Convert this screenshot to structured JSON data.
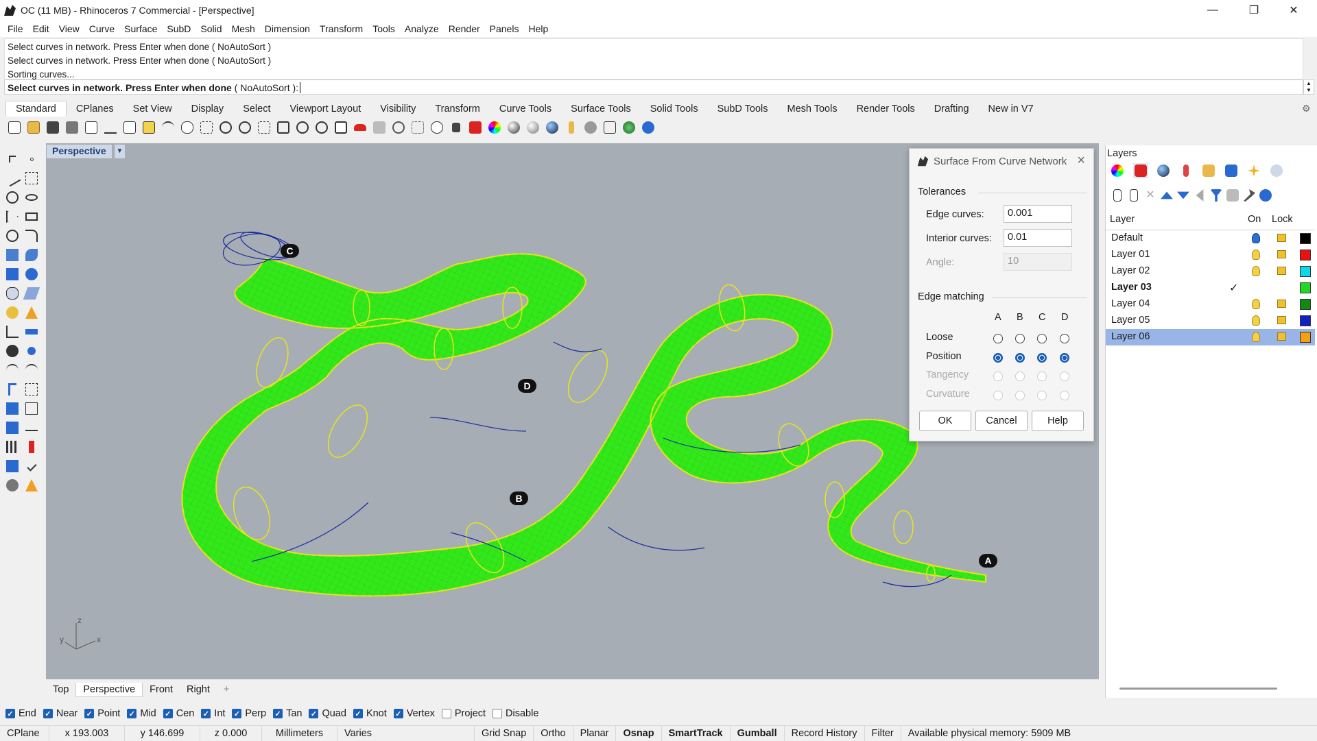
{
  "window": {
    "title": "OC (11 MB) - Rhinoceros 7 Commercial - [Perspective]",
    "minimize": "—",
    "restore": "❐",
    "close": "✕"
  },
  "menu": [
    "File",
    "Edit",
    "View",
    "Curve",
    "Surface",
    "SubD",
    "Solid",
    "Mesh",
    "Dimension",
    "Transform",
    "Tools",
    "Analyze",
    "Render",
    "Panels",
    "Help"
  ],
  "command": {
    "history": [
      "Select curves in network. Press Enter when done ( NoAutoSort )",
      "Select curves in network. Press Enter when done ( NoAutoSort )",
      "Sorting curves..."
    ],
    "prompt": "Select curves in network. Press Enter when done",
    "options": " ( NoAutoSort ):"
  },
  "toolbar_tabs": [
    "Standard",
    "CPlanes",
    "Set View",
    "Display",
    "Select",
    "Viewport Layout",
    "Visibility",
    "Transform",
    "Curve Tools",
    "Surface Tools",
    "Solid Tools",
    "SubD Tools",
    "Mesh Tools",
    "Render Tools",
    "Drafting",
    "New in V7"
  ],
  "viewport": {
    "title": "Perspective",
    "markers": [
      "A",
      "B",
      "C",
      "D"
    ],
    "axes": {
      "x": "x",
      "y": "y",
      "z": "z"
    },
    "surface_color": "#33e81a",
    "background": "#a7adb4"
  },
  "viewport_tabs": [
    "Top",
    "Perspective",
    "Front",
    "Right",
    "+"
  ],
  "osnaps": [
    {
      "label": "End",
      "checked": true
    },
    {
      "label": "Near",
      "checked": true
    },
    {
      "label": "Point",
      "checked": true
    },
    {
      "label": "Mid",
      "checked": true
    },
    {
      "label": "Cen",
      "checked": true
    },
    {
      "label": "Int",
      "checked": true
    },
    {
      "label": "Perp",
      "checked": true
    },
    {
      "label": "Tan",
      "checked": true
    },
    {
      "label": "Quad",
      "checked": true
    },
    {
      "label": "Knot",
      "checked": true
    },
    {
      "label": "Vertex",
      "checked": true
    },
    {
      "label": "Project",
      "checked": false
    },
    {
      "label": "Disable",
      "checked": false
    }
  ],
  "status": {
    "cplane": "CPlane",
    "x": "x 193.003",
    "y": "y 146.699",
    "z": "z 0.000",
    "units": "Millimeters",
    "layer": "Varies",
    "grid_snap": "Grid Snap",
    "ortho": "Ortho",
    "planar": "Planar",
    "osnap": "Osnap",
    "smarttrack": "SmartTrack",
    "gumball": "Gumball",
    "record_history": "Record History",
    "filter": "Filter",
    "memory": "Available physical memory: 5909 MB"
  },
  "dialog": {
    "title": "Surface From Curve Network",
    "tolerances_label": "Tolerances",
    "edge_curves_label": "Edge curves:",
    "edge_curves_value": "0.001",
    "interior_curves_label": "Interior curves:",
    "interior_curves_value": "0.01",
    "angle_label": "Angle:",
    "angle_value": "10",
    "edge_matching_label": "Edge matching",
    "columns": [
      "A",
      "B",
      "C",
      "D"
    ],
    "rows": [
      {
        "label": "Loose",
        "enabled": true,
        "selected": [
          false,
          false,
          false,
          false
        ]
      },
      {
        "label": "Position",
        "enabled": true,
        "selected": [
          true,
          true,
          true,
          true
        ]
      },
      {
        "label": "Tangency",
        "enabled": false,
        "selected": [
          false,
          false,
          false,
          false
        ]
      },
      {
        "label": "Curvature",
        "enabled": false,
        "selected": [
          false,
          false,
          false,
          false
        ]
      }
    ],
    "ok": "OK",
    "cancel": "Cancel",
    "help": "Help"
  },
  "layers_panel": {
    "title": "Layers",
    "col_layer": "Layer",
    "col_on": "On",
    "col_lock": "Lock",
    "layers": [
      {
        "name": "Default",
        "color": "#000000",
        "current": false,
        "selected": false,
        "bulb": "blue"
      },
      {
        "name": "Layer 01",
        "color": "#e81010",
        "current": false,
        "selected": false,
        "bulb": "yellow"
      },
      {
        "name": "Layer 02",
        "color": "#10d8e8",
        "current": false,
        "selected": false,
        "bulb": "yellow"
      },
      {
        "name": "Layer 03",
        "color": "#22d822",
        "current": true,
        "selected": false,
        "bulb": "none"
      },
      {
        "name": "Layer 04",
        "color": "#118a11",
        "current": false,
        "selected": false,
        "bulb": "yellow"
      },
      {
        "name": "Layer 05",
        "color": "#1020c0",
        "current": false,
        "selected": false,
        "bulb": "yellow"
      },
      {
        "name": "Layer 06",
        "color": "#f5a010",
        "current": false,
        "selected": true,
        "bulb": "yellow"
      }
    ],
    "current_mark": "✓"
  }
}
